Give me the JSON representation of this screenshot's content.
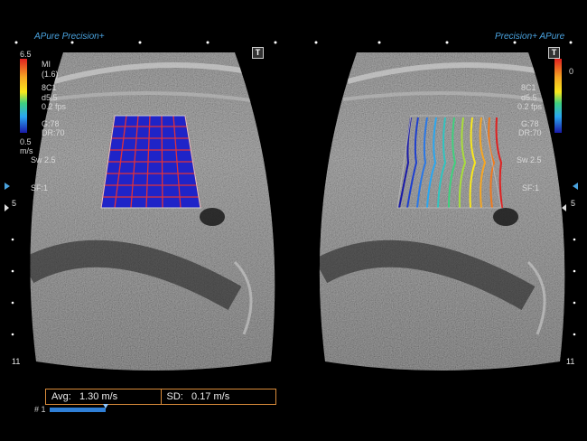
{
  "header": {
    "left_brand": "APure Precision+",
    "right_brand": "Precision+ APure",
    "toggle_label": "T"
  },
  "left_panel": {
    "color_scale": {
      "top": "6.5",
      "bottom": "0.5",
      "unit": "m/s"
    },
    "params": [
      "MI",
      "(1.6)",
      "8C1",
      "d5.5",
      "0.2 fps",
      "G:78",
      "DR:70",
      "Sw 2.5",
      "SF:1"
    ],
    "depth_ticks": [
      "5",
      "11"
    ]
  },
  "right_panel": {
    "color_scale": {
      "top": "0"
    },
    "params": [
      "8C1",
      "d5.5",
      "0.2 fps",
      "G:78",
      "DR:70",
      "Sw 2.5",
      "SF:1"
    ],
    "depth_ticks": [
      "5",
      "11"
    ]
  },
  "measurement": {
    "avg_label": "Avg:",
    "avg_value": "1.30 m/s",
    "sd_label": "SD:",
    "sd_value": "0.17 m/s"
  },
  "cine": {
    "label": "# 1"
  },
  "colors": {
    "brand": "#4aa3df",
    "stats_border": "#d98b3a",
    "grid_line": "#e0303a",
    "roi_fill": "#1f24c8"
  },
  "icons": [
    "t-button-icon",
    "color-scale-bar-icon",
    "grid-overlay-icon",
    "wave-contours-icon"
  ]
}
